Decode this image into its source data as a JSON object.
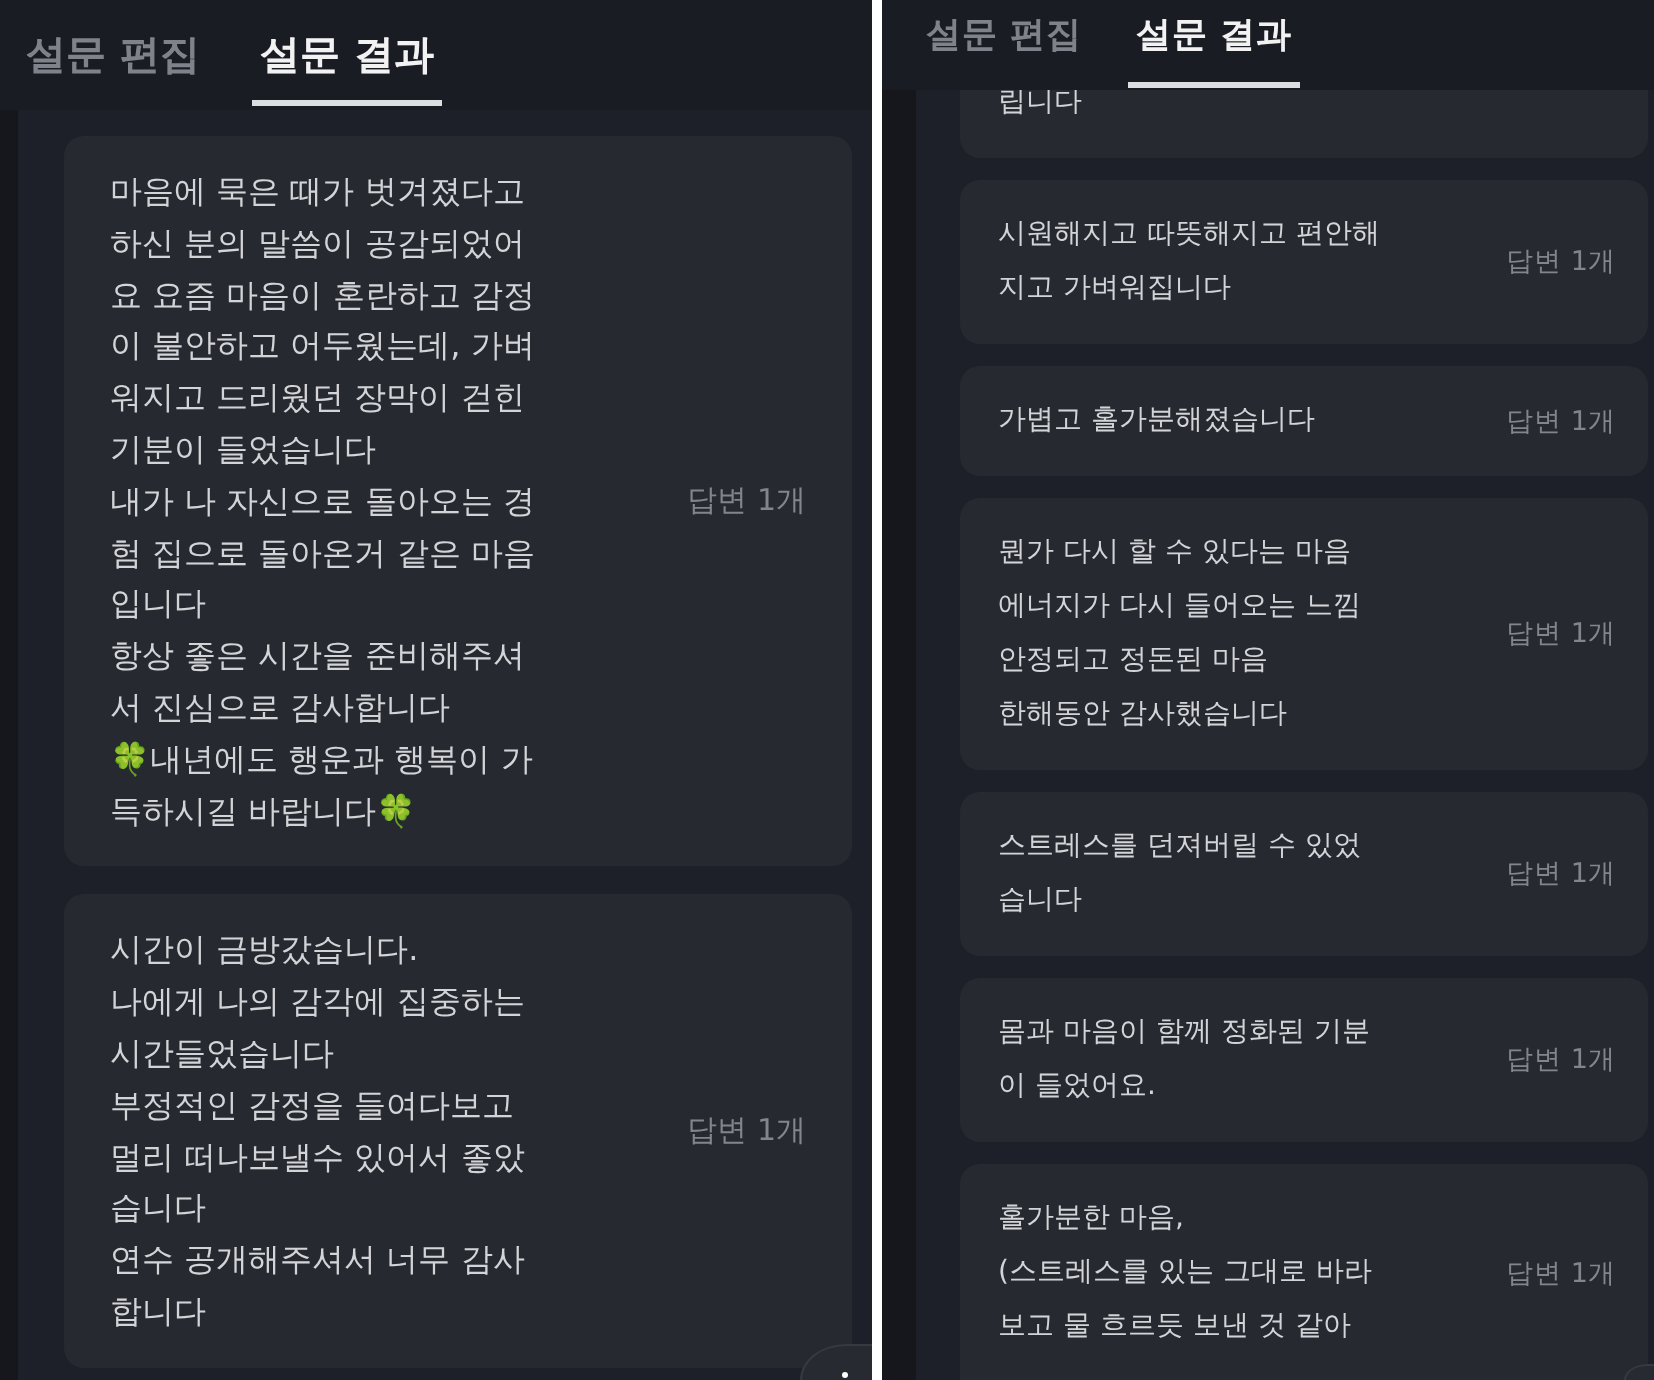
{
  "screens": [
    {
      "tabs": [
        {
          "label": "설문 편집",
          "selected": false
        },
        {
          "label": "설문 결과",
          "selected": true
        }
      ],
      "answers": [
        {
          "text": "마음에 묵은 때가 벗겨졌다고\n하신 분의 말씀이 공감되었어\n요 요즘 마음이 혼란하고 감정\n이 불안하고 어두웠는데, 가벼\n워지고 드리웠던 장막이 걷힌\n기분이 들었습니다\n내가 나 자신으로 돌아오는 경\n험 집으로 돌아온거 같은 마음\n입니다\n항상 좋은 시간을 준비해주셔\n서 진심으로 감사합니다\n🍀내년에도 행운과 행복이 가\n득하시길 바랍니다🍀",
          "count": "답변 1개",
          "cut_top": false,
          "cut_bottom": false
        },
        {
          "text": "시간이 금방갔습니다.\n나에게 나의 감각에 집중하는\n시간들었습니다\n부정적인 감정을 들여다보고\n멀리 떠나보낼수 있어서 좋았\n습니다\n연수 공개해주셔서 너무 감사\n합니다",
          "count": "답변 1개",
          "cut_top": false,
          "cut_bottom": false
        }
      ]
    },
    {
      "tabs": [
        {
          "label": "설문 편집",
          "selected": false
        },
        {
          "label": "설문 결과",
          "selected": true
        }
      ],
      "answers": [
        {
          "text": "립니다",
          "cut_top": true,
          "cut_bottom": false
        },
        {
          "text": "시원해지고 따뜻해지고 편안해\n지고 가벼워집니다",
          "count": "답변 1개",
          "cut_top": false,
          "cut_bottom": false
        },
        {
          "text": "가볍고 홀가분해졌습니다",
          "count": "답변 1개",
          "cut_top": false,
          "cut_bottom": false
        },
        {
          "text": "뭔가 다시 할 수 있다는 마음\n에너지가 다시 들어오는 느낌\n안정되고 정돈된 마음\n한해동안 감사했습니다",
          "count": "답변 1개",
          "cut_top": false,
          "cut_bottom": false
        },
        {
          "text": "스트레스를 던져버릴 수 있었\n습니다",
          "count": "답변 1개",
          "cut_top": false,
          "cut_bottom": false
        },
        {
          "text": "몸과 마음이 함께 정화된 기분\n이 들었어요.",
          "count": "답변 1개",
          "cut_top": false,
          "cut_bottom": false
        },
        {
          "text": "홀가분한 마음,\n(스트레스를 있는 그대로 바라\n보고 물 흐르듯 보낸 것 같아",
          "count": "답변 1개",
          "cut_top": false,
          "cut_bottom": true
        }
      ]
    }
  ]
}
